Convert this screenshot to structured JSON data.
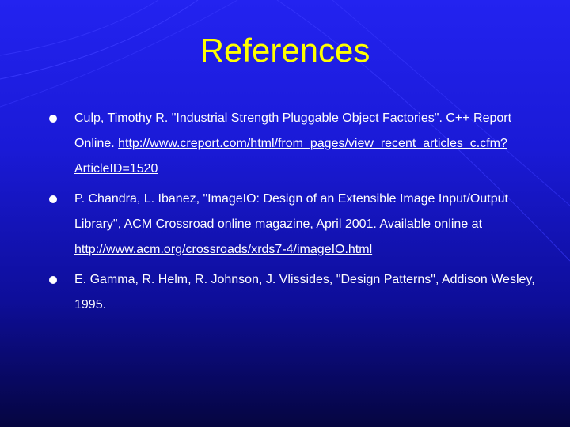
{
  "slide": {
    "title": "References",
    "references": [
      {
        "text_before": "Culp, Timothy R. \"Industrial Strength Pluggable Object Factories\". C++ Report Online. ",
        "link": "http://www.creport.com/html/from_pages/view_recent_articles_c.cfm?ArticleID=1520",
        "text_after": ""
      },
      {
        "text_before": "P. Chandra, L. Ibanez, \"ImageIO: Design of an Extensible Image Input/Output Library\", ACM Crossroad online magazine, April 2001. Available online at ",
        "link": "http://www.acm.org/crossroads/xrds7-4/imageIO.html",
        "text_after": ""
      },
      {
        "text_before": "E. Gamma, R. Helm, R. Johnson, J. Vlissides, \"Design Patterns\", Addison Wesley, 1995.",
        "link": "",
        "text_after": ""
      }
    ]
  },
  "colors": {
    "background_top": "#2323f0",
    "background_bottom": "#050540",
    "title": "#ffff00",
    "body_text": "#ffffff"
  }
}
